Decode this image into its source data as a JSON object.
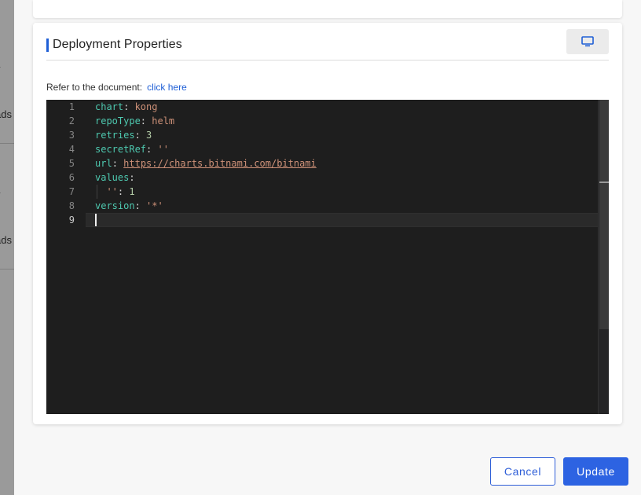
{
  "backdrop": {
    "fragments": [
      "y",
      "ads",
      "y",
      "ads"
    ]
  },
  "section": {
    "title": "Deployment Properties",
    "fullscreen_icon": "monitor-icon"
  },
  "doc": {
    "label": "Refer to the document:",
    "link_text": "click here"
  },
  "editor": {
    "line_numbers": [
      "1",
      "2",
      "3",
      "4",
      "5",
      "6",
      "7",
      "8",
      "9"
    ],
    "active_line": 9,
    "lines": [
      {
        "key": "chart",
        "value": "kong",
        "type": "string"
      },
      {
        "key": "repoType",
        "value": "helm",
        "type": "string"
      },
      {
        "key": "retries",
        "value": "3",
        "type": "number"
      },
      {
        "key": "secretRef",
        "value": "''",
        "type": "string"
      },
      {
        "key": "url",
        "value": "https://charts.bitnami.com/bitnami",
        "type": "url"
      },
      {
        "key": "values",
        "value": "",
        "type": "map"
      },
      {
        "key": "''",
        "value": "1",
        "type": "number",
        "indent": "  "
      },
      {
        "key": "version",
        "value": "'*'",
        "type": "string"
      },
      {
        "key": "",
        "value": "",
        "type": "empty"
      }
    ],
    "colors": {
      "background": "#1e1e1e",
      "key": "#4ec9b0",
      "string": "#ce9178",
      "number": "#b5cea8"
    }
  },
  "actions": {
    "cancel_label": "Cancel",
    "update_label": "Update"
  },
  "colors": {
    "accent": "#2d63e2"
  }
}
